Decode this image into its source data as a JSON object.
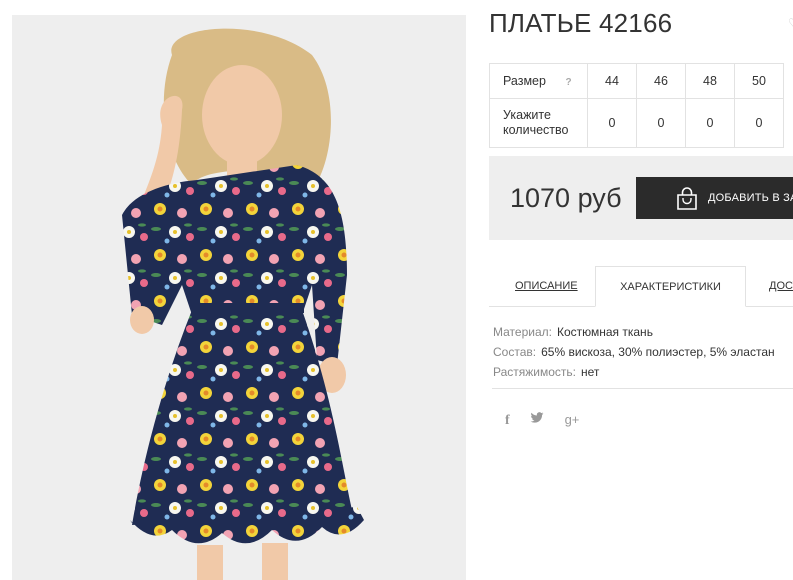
{
  "product": {
    "title": "ПЛАТЬЕ 42166",
    "image_alt": "Floral dress photo"
  },
  "sizes": {
    "size_label": "Размер",
    "help_icon": "?",
    "qty_label_line1": "Укажите",
    "qty_label_line2": "количество",
    "columns": [
      "44",
      "46",
      "48",
      "50"
    ],
    "quantities": [
      "0",
      "0",
      "0",
      "0"
    ]
  },
  "purchase": {
    "price": "1070 руб",
    "add_button_label": "ДОБАВИТЬ В ЗА"
  },
  "tabs": [
    {
      "label": "ОПИСАНИЕ"
    },
    {
      "label": "ХАРАКТЕРИСТИКИ",
      "active": true
    },
    {
      "label": "ДОСТ"
    }
  ],
  "specs": [
    {
      "key": "Материал:",
      "value": "Костюмная ткань"
    },
    {
      "key": "Состав:",
      "value": "65% вискоза, 30% полиэстер, 5% эластан"
    },
    {
      "key": "Растяжимость:",
      "value": "нет"
    }
  ],
  "social": {
    "facebook": "f",
    "twitter": "t",
    "googleplus": "g+"
  }
}
